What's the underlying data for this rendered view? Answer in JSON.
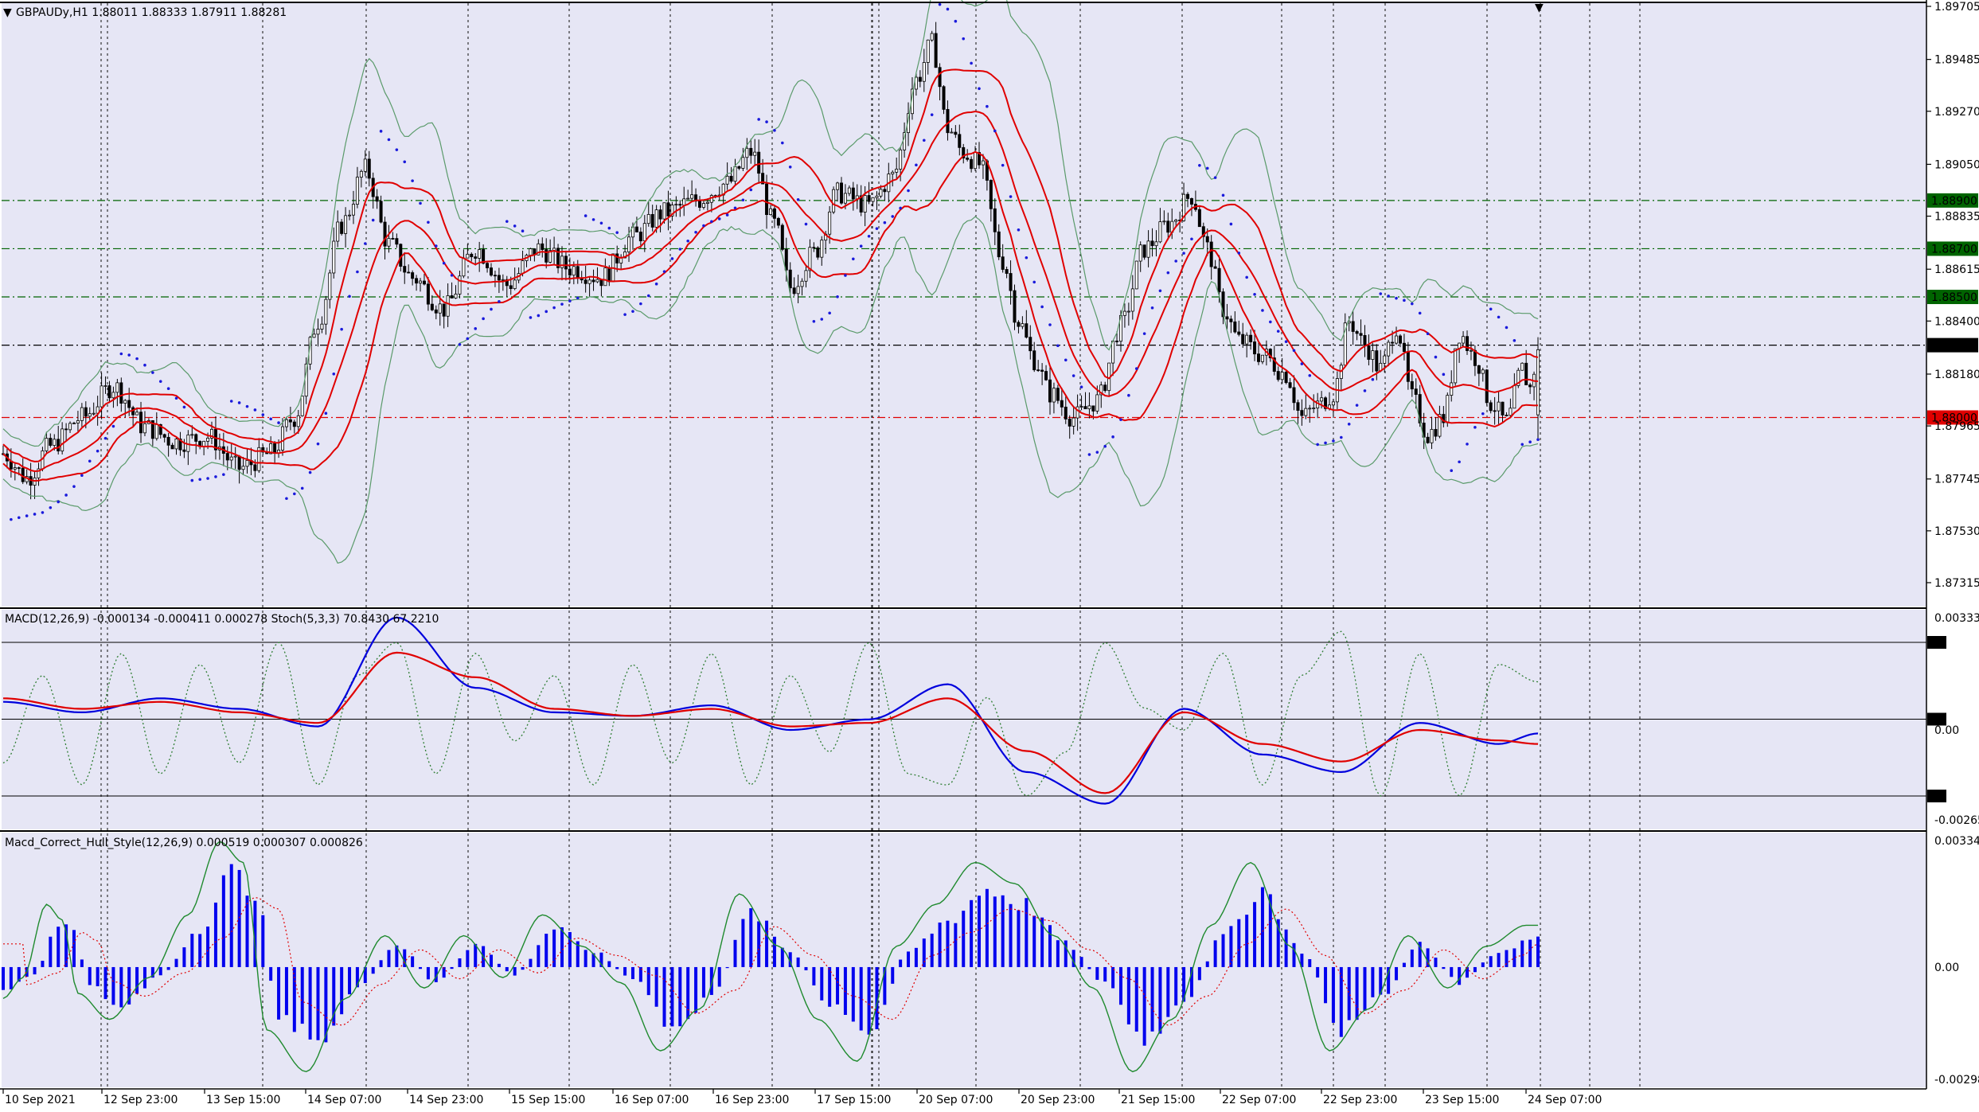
{
  "colors": {
    "background": "#e6e6f5",
    "candle_bear": "#000000",
    "candle_bull_fill": "#ffffff",
    "bb_outer": "#5a9a6a",
    "bb_red": "#e00000",
    "psar": "#1a1adb",
    "macd_main": "#0000dd",
    "macd_signal": "#e00000",
    "stoch": "#2e7d32",
    "hist": "#0000ee",
    "hull_green": "#1f8a2e",
    "hull_red_dotted": "#e00000",
    "level_green": "#006400",
    "level_red": "#e00000",
    "level_black": "#000000"
  },
  "main": {
    "header": "GBPAUDy,H1  1.88011 1.88333 1.87911 1.88281",
    "price_axis": [
      "1.89705",
      "1.89485",
      "1.89270",
      "1.89050",
      "1.88835",
      "1.88615",
      "1.88400",
      "1.88180",
      "1.87965",
      "1.87745",
      "1.87530",
      "1.87315"
    ],
    "levels": [
      {
        "label": "1.88900",
        "price": 1.889,
        "color": "green"
      },
      {
        "label": "1.88700",
        "price": 1.887,
        "color": "green"
      },
      {
        "label": "1.88500",
        "price": 1.885,
        "color": "green"
      },
      {
        "label": "1.88300",
        "price": 1.883,
        "color": "black"
      },
      {
        "label": "1.88000",
        "price": 1.88,
        "color": "red"
      }
    ]
  },
  "macd_pane": {
    "header": "MACD(12,26,9) -0.000134 -0.000411 0.000278  Stoch(5,3,3) 70.8430 67.2210",
    "axis_top": "0.003332",
    "axis_zero": "0.00",
    "axis_bottom": "-0.002652",
    "stoch_levels": [
      "85",
      "50",
      "15"
    ]
  },
  "hull_pane": {
    "header": "Macd_Correct_Hull_Style(12,26,9) 0.000519 0.000307 0.000826",
    "axis_top": "0.003349",
    "axis_zero": "0.00",
    "axis_bottom": "-0.002981"
  },
  "time_axis": [
    "10 Sep 2021",
    "12 Sep 23:00",
    "13 Sep 15:00",
    "14 Sep 07:00",
    "14 Sep 23:00",
    "15 Sep 15:00",
    "16 Sep 07:00",
    "16 Sep 23:00",
    "17 Sep 15:00",
    "20 Sep 07:00",
    "20 Sep 23:00",
    "21 Sep 15:00",
    "22 Sep 07:00",
    "22 Sep 23:00",
    "23 Sep 15:00",
    "24 Sep 07:00"
  ],
  "chart_data": [
    {
      "type": "candlestick",
      "title": "GBPAUDy,H1",
      "ohlc_last": {
        "open": 1.88011,
        "high": 1.88333,
        "low": 1.87911,
        "close": 1.88281
      },
      "price_path": [
        [
          0,
          1.8785
        ],
        [
          6,
          1.8775
        ],
        [
          12,
          1.8788
        ],
        [
          20,
          1.88
        ],
        [
          28,
          1.8813
        ],
        [
          36,
          1.8796
        ],
        [
          44,
          1.879
        ],
        [
          52,
          1.8792
        ],
        [
          60,
          1.8779
        ],
        [
          68,
          1.8785
        ],
        [
          74,
          1.88
        ],
        [
          80,
          1.884
        ],
        [
          86,
          1.888
        ],
        [
          92,
          1.8903
        ],
        [
          98,
          1.8872
        ],
        [
          104,
          1.8858
        ],
        [
          112,
          1.8845
        ],
        [
          120,
          1.887
        ],
        [
          128,
          1.8855
        ],
        [
          136,
          1.887
        ],
        [
          144,
          1.8862
        ],
        [
          152,
          1.8858
        ],
        [
          160,
          1.8875
        ],
        [
          168,
          1.8885
        ],
        [
          176,
          1.889
        ],
        [
          184,
          1.8897
        ],
        [
          190,
          1.891
        ],
        [
          196,
          1.888
        ],
        [
          200,
          1.8854
        ],
        [
          206,
          1.8868
        ],
        [
          212,
          1.8893
        ],
        [
          220,
          1.8888
        ],
        [
          226,
          1.89
        ],
        [
          232,
          1.894
        ],
        [
          236,
          1.8955
        ],
        [
          240,
          1.892
        ],
        [
          244,
          1.891
        ],
        [
          248,
          1.8905
        ],
        [
          254,
          1.8865
        ],
        [
          258,
          1.884
        ],
        [
          262,
          1.8824
        ],
        [
          266,
          1.881
        ],
        [
          272,
          1.88
        ],
        [
          278,
          1.8807
        ],
        [
          284,
          1.8838
        ],
        [
          290,
          1.887
        ],
        [
          296,
          1.888
        ],
        [
          302,
          1.8892
        ],
        [
          306,
          1.887
        ],
        [
          310,
          1.8845
        ],
        [
          314,
          1.8832
        ],
        [
          320,
          1.8826
        ],
        [
          326,
          1.8818
        ],
        [
          330,
          1.88
        ],
        [
          334,
          1.8805
        ],
        [
          338,
          1.881
        ],
        [
          342,
          1.884
        ],
        [
          346,
          1.883
        ],
        [
          350,
          1.882
        ],
        [
          354,
          1.8838
        ],
        [
          358,
          1.8808
        ],
        [
          362,
          1.8793
        ],
        [
          366,
          1.88
        ],
        [
          370,
          1.8835
        ],
        [
          374,
          1.8825
        ],
        [
          378,
          1.8806
        ],
        [
          382,
          1.8798
        ],
        [
          386,
          1.882
        ],
        [
          388,
          1.8812
        ],
        [
          390,
          1.8828
        ]
      ],
      "series": [
        {
          "name": "Bollinger Bands (outer)"
        },
        {
          "name": "Bollinger Bands (inner)"
        },
        {
          "name": "Parabolic SAR"
        }
      ]
    },
    {
      "type": "line",
      "title": "MACD(12,26,9)",
      "series": [
        {
          "name": "MACD main",
          "values_path": [
            [
              0,
              0.0008
            ],
            [
              20,
              0.0005
            ],
            [
              40,
              0.0009
            ],
            [
              60,
              0.0006
            ],
            [
              80,
              0.0001
            ],
            [
              100,
              0.0032
            ],
            [
              120,
              0.0012
            ],
            [
              140,
              0.0005
            ],
            [
              160,
              0.0004
            ],
            [
              180,
              0.0007
            ],
            [
              200,
              0.0
            ],
            [
              220,
              0.0003
            ],
            [
              240,
              0.0013
            ],
            [
              260,
              -0.0012
            ],
            [
              280,
              -0.0021
            ],
            [
              300,
              0.0006
            ],
            [
              320,
              -0.0007
            ],
            [
              340,
              -0.0012
            ],
            [
              360,
              0.0002
            ],
            [
              380,
              -0.0004
            ],
            [
              390,
              -0.0001
            ]
          ]
        },
        {
          "name": "Signal",
          "values_path": [
            [
              0,
              0.0009
            ],
            [
              20,
              0.0006
            ],
            [
              40,
              0.0008
            ],
            [
              60,
              0.0005
            ],
            [
              80,
              0.0002
            ],
            [
              100,
              0.0022
            ],
            [
              120,
              0.0015
            ],
            [
              140,
              0.0006
            ],
            [
              160,
              0.0004
            ],
            [
              180,
              0.0006
            ],
            [
              200,
              0.0001
            ],
            [
              220,
              0.0002
            ],
            [
              240,
              0.0009
            ],
            [
              260,
              -0.0006
            ],
            [
              280,
              -0.0018
            ],
            [
              300,
              0.0005
            ],
            [
              320,
              -0.0004
            ],
            [
              340,
              -0.0009
            ],
            [
              360,
              0.0
            ],
            [
              380,
              -0.0003
            ],
            [
              390,
              -0.0004
            ]
          ]
        },
        {
          "name": "Stoch",
          "values_path": [
            [
              0,
              30
            ],
            [
              10,
              70
            ],
            [
              20,
              20
            ],
            [
              30,
              80
            ],
            [
              40,
              25
            ],
            [
              50,
              75
            ],
            [
              60,
              30
            ],
            [
              70,
              85
            ],
            [
              80,
              20
            ],
            [
              90,
              70
            ],
            [
              100,
              85
            ],
            [
              110,
              25
            ],
            [
              120,
              80
            ],
            [
              130,
              40
            ],
            [
              140,
              70
            ],
            [
              150,
              20
            ],
            [
              160,
              75
            ],
            [
              170,
              30
            ],
            [
              180,
              80
            ],
            [
              190,
              20
            ],
            [
              200,
              70
            ],
            [
              210,
              35
            ],
            [
              220,
              85
            ],
            [
              230,
              25
            ],
            [
              240,
              20
            ],
            [
              250,
              60
            ],
            [
              260,
              15
            ],
            [
              270,
              35
            ],
            [
              280,
              85
            ],
            [
              290,
              55
            ],
            [
              300,
              45
            ],
            [
              310,
              80
            ],
            [
              320,
              20
            ],
            [
              330,
              70
            ],
            [
              340,
              90
            ],
            [
              350,
              15
            ],
            [
              360,
              80
            ],
            [
              370,
              15
            ],
            [
              380,
              75
            ],
            [
              390,
              67
            ]
          ]
        }
      ]
    },
    {
      "type": "bar",
      "title": "Macd_Correct_Hull_Style(12,26,9)",
      "histogram_path": [
        [
          0,
          -0.0006
        ],
        [
          8,
          -0.0002
        ],
        [
          14,
          0.0012
        ],
        [
          18,
          0.0009
        ],
        [
          22,
          -0.0005
        ],
        [
          30,
          -0.001
        ],
        [
          40,
          -0.0002
        ],
        [
          50,
          0.001
        ],
        [
          58,
          0.0024
        ],
        [
          64,
          0.002
        ],
        [
          70,
          -0.0012
        ],
        [
          80,
          -0.002
        ],
        [
          90,
          -0.0006
        ],
        [
          100,
          0.0006
        ],
        [
          110,
          -0.0004
        ],
        [
          120,
          0.0006
        ],
        [
          130,
          -0.0002
        ],
        [
          140,
          0.001
        ],
        [
          150,
          0.0004
        ],
        [
          160,
          -0.0003
        ],
        [
          170,
          -0.0016
        ],
        [
          180,
          -0.0008
        ],
        [
          190,
          0.0014
        ],
        [
          200,
          0.0004
        ],
        [
          210,
          -0.001
        ],
        [
          220,
          -0.0018
        ],
        [
          230,
          0.0004
        ],
        [
          240,
          0.0012
        ],
        [
          250,
          0.002
        ],
        [
          260,
          0.0016
        ],
        [
          270,
          0.0006
        ],
        [
          280,
          -0.0004
        ],
        [
          290,
          -0.002
        ],
        [
          300,
          -0.001
        ],
        [
          310,
          0.0008
        ],
        [
          320,
          0.002
        ],
        [
          330,
          0.0004
        ],
        [
          340,
          -0.0016
        ],
        [
          350,
          -0.0008
        ],
        [
          360,
          0.0006
        ],
        [
          370,
          -0.0004
        ],
        [
          380,
          0.0004
        ],
        [
          390,
          0.0008
        ]
      ],
      "series": [
        {
          "name": "Hull MACD"
        },
        {
          "name": "Signal (dotted)"
        }
      ]
    }
  ]
}
